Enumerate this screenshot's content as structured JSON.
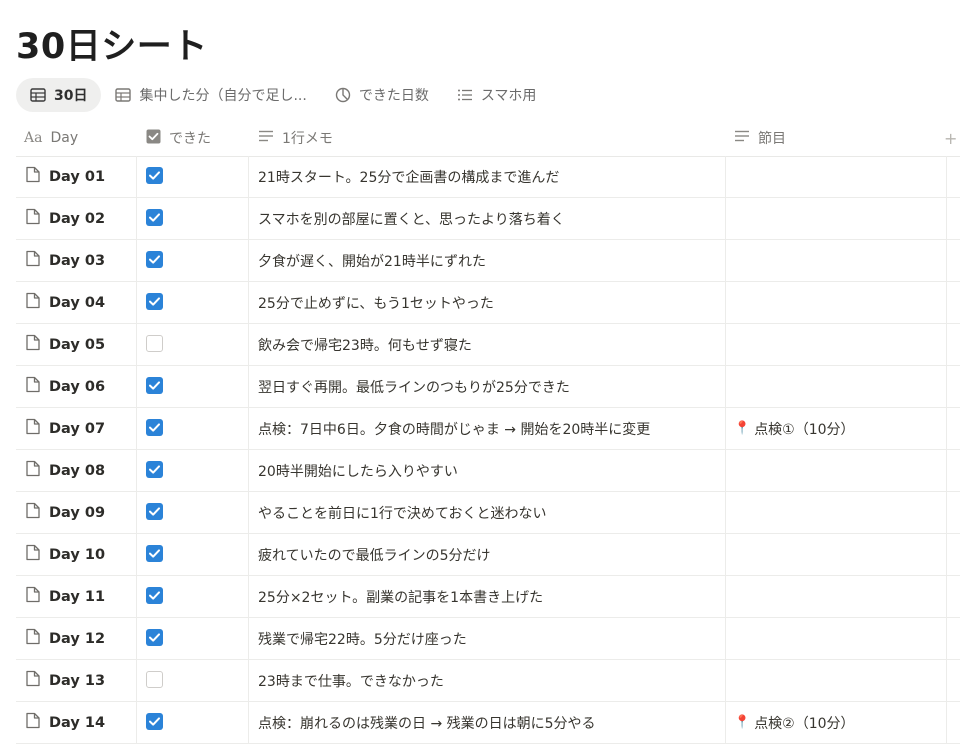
{
  "page": {
    "title": "30日シート"
  },
  "views": [
    {
      "label": "30日",
      "icon": "table-icon",
      "active": true
    },
    {
      "label": "集中した分（自分で足し...",
      "icon": "table-icon",
      "active": false
    },
    {
      "label": "できた日数",
      "icon": "chart-icon",
      "active": false
    },
    {
      "label": "スマホ用",
      "icon": "list-icon",
      "active": false
    }
  ],
  "columns": {
    "day": "Day",
    "done": "できた",
    "memo": "1行メモ",
    "node": "節目"
  },
  "rows": [
    {
      "day": "Day 01",
      "done": true,
      "memo": "21時スタート。25分で企画書の構成まで進んだ",
      "node": ""
    },
    {
      "day": "Day 02",
      "done": true,
      "memo": "スマホを別の部屋に置くと、思ったより落ち着く",
      "node": ""
    },
    {
      "day": "Day 03",
      "done": true,
      "memo": "夕食が遅く、開始が21時半にずれた",
      "node": ""
    },
    {
      "day": "Day 04",
      "done": true,
      "memo": "25分で止めずに、もう1セットやった",
      "node": ""
    },
    {
      "day": "Day 05",
      "done": false,
      "memo": "飲み会で帰宅23時。何もせず寝た",
      "node": ""
    },
    {
      "day": "Day 06",
      "done": true,
      "memo": "翌日すぐ再開。最低ラインのつもりが25分できた",
      "node": ""
    },
    {
      "day": "Day 07",
      "done": true,
      "memo": "点検：7日中6日。夕食の時間がじゃま → 開始を20時半に変更",
      "node": "点検①（10分）"
    },
    {
      "day": "Day 08",
      "done": true,
      "memo": "20時半開始にしたら入りやすい",
      "node": ""
    },
    {
      "day": "Day 09",
      "done": true,
      "memo": "やることを前日に1行で決めておくと迷わない",
      "node": ""
    },
    {
      "day": "Day 10",
      "done": true,
      "memo": "疲れていたので最低ラインの5分だけ",
      "node": ""
    },
    {
      "day": "Day 11",
      "done": true,
      "memo": "25分×2セット。副業の記事を1本書き上げた",
      "node": ""
    },
    {
      "day": "Day 12",
      "done": true,
      "memo": "残業で帰宅22時。5分だけ座った",
      "node": ""
    },
    {
      "day": "Day 13",
      "done": false,
      "memo": "23時まで仕事。できなかった",
      "node": ""
    },
    {
      "day": "Day 14",
      "done": true,
      "memo": "点検：崩れるのは残業の日 → 残業の日は朝に5分やる",
      "node": "点検②（10分）"
    }
  ],
  "colors": {
    "checkbox_on": "#2b83d8",
    "pin": "#d84d3c"
  }
}
